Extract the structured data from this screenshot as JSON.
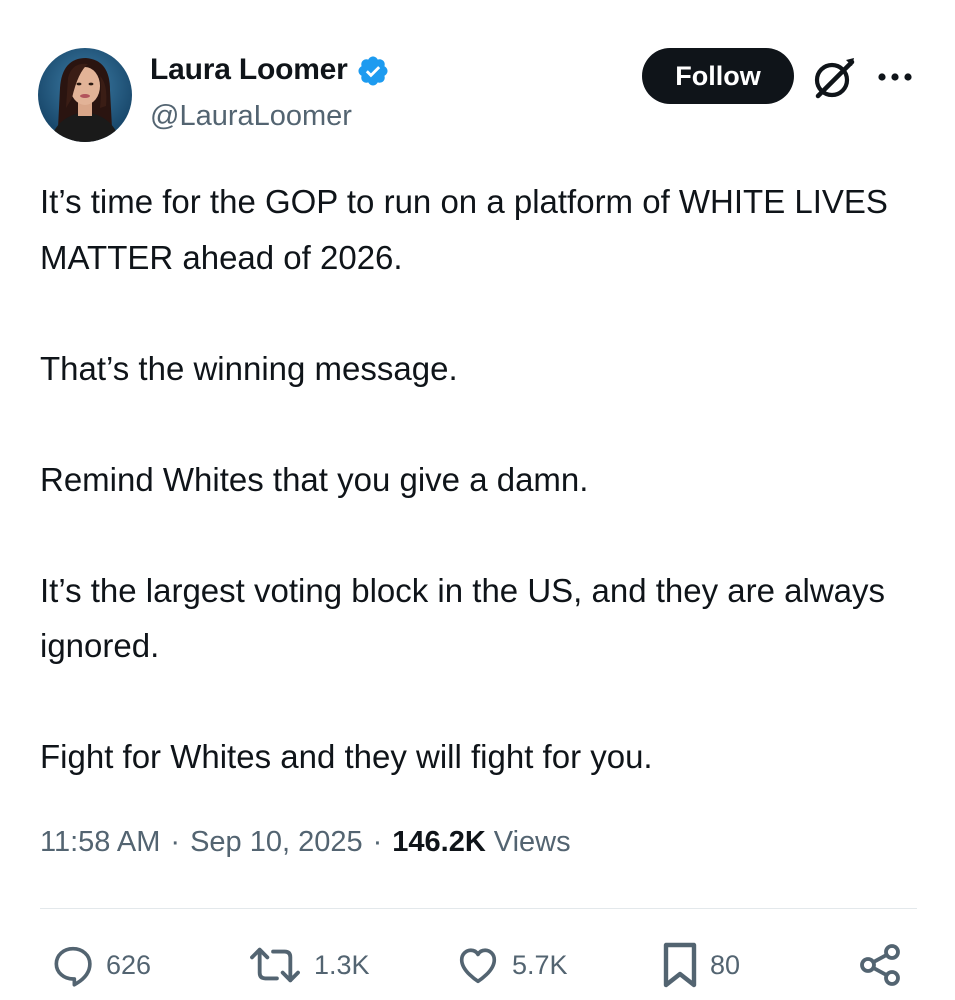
{
  "author": {
    "display_name": "Laura Loomer",
    "handle": "@LauraLoomer",
    "verified_color": "#1d9bf0"
  },
  "header": {
    "follow_label": "Follow",
    "grok_icon": "grok-icon",
    "more_icon": "more-options-icon"
  },
  "tweet": {
    "paragraphs": [
      "It’s time for the GOP to run on a platform of WHITE LIVES MATTER ahead of 2026.",
      "That’s the winning message.",
      "Remind Whites that you give a damn.",
      "It’s the largest voting block in the US, and they are always ignored.",
      "Fight for Whites and they will fight for you."
    ],
    "time": "11:58 AM",
    "date": "Sep 10, 2025",
    "separator": "·",
    "views_count": "146.2K",
    "views_label": "Views"
  },
  "actions": {
    "replies": "626",
    "reposts": "1.3K",
    "likes": "5.7K",
    "bookmarks": "80"
  },
  "colors": {
    "text": "#0f1419",
    "secondary": "#536471",
    "button_bg": "#0f1419",
    "divider": "#e3e8eb"
  }
}
